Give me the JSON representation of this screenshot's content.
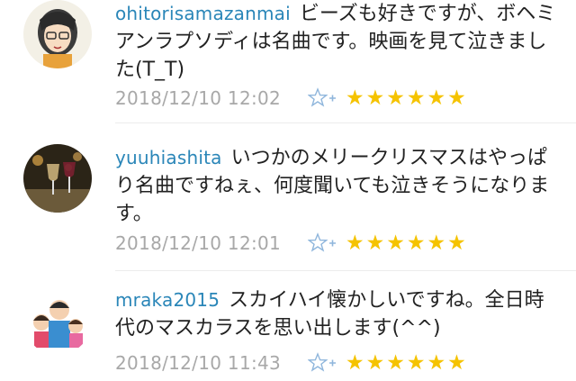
{
  "comments": [
    {
      "user": "ohitorisamazanmai",
      "text": "ビーズも好きですが、ボヘミアンラプソディは名曲です。映画を見て泣きました(T_T)",
      "time": "2018/12/10 12:02",
      "stars": "★★★★★★"
    },
    {
      "user": "yuuhiashita",
      "text": "いつかのメリークリスマスはやっぱり名曲ですねぇ、何度聞いても泣きそうになります。",
      "time": "2018/12/10 12:01",
      "stars": "★★★★★★"
    },
    {
      "user": "mraka2015",
      "text": "スカイハイ懐かしいですね。全日時代のマスカラスを思い出します(^^)",
      "time": "2018/12/10 11:43",
      "stars": "★★★★★★"
    }
  ],
  "colors": {
    "username": "#2a86b8",
    "star": "#f5c300",
    "timestamp": "#a8a8a8"
  },
  "icons": {
    "add_star": "star-plus-icon"
  }
}
